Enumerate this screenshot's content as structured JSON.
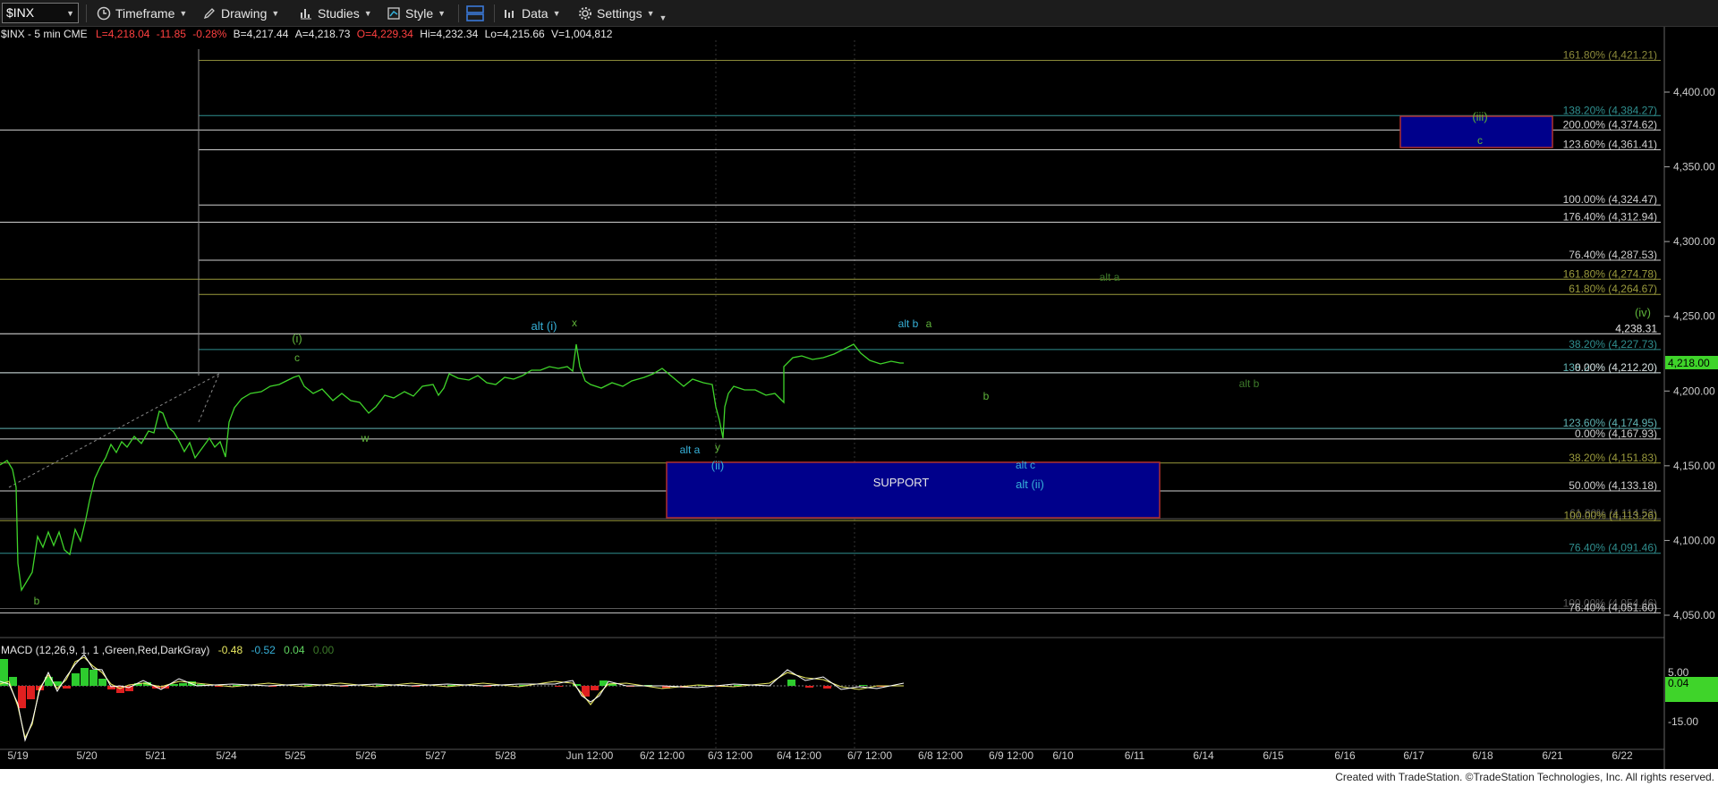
{
  "toolbar": {
    "symbol": "$INX",
    "timeframe": "Timeframe",
    "drawing": "Drawing",
    "studies": "Studies",
    "style": "Style",
    "data": "Data",
    "settings": "Settings"
  },
  "header": {
    "name": "$INX - 5 min  CME",
    "last": "L=4,218.04",
    "change": "-11.85",
    "pct": "-0.28%",
    "bid": "B=4,217.44",
    "ask": "A=4,218.73",
    "open": "O=4,229.34",
    "hi": "Hi=4,232.34",
    "lo": "Lo=4,215.66",
    "vol": "V=1,004,812"
  },
  "price_axis": [
    "4,400.00",
    "4,350.00",
    "4,300.00",
    "4,250.00",
    "4,200.00",
    "4,150.00",
    "4,100.00",
    "4,050.00"
  ],
  "last_price_tag": "4,218.00",
  "time_axis": [
    "5/19",
    "5/20",
    "5/21",
    "5/24",
    "5/25",
    "5/26",
    "5/27",
    "5/28",
    "Jun 12:00",
    "6/2 12:00",
    "6/3 12:00",
    "6/4 12:00",
    "6/7 12:00",
    "6/8 12:00",
    "6/9 12:00",
    "6/10",
    "6/11",
    "6/14",
    "6/15",
    "6/16",
    "6/17",
    "6/18",
    "6/21",
    "6/22"
  ],
  "fib_levels": [
    {
      "label": "161.80% (4,421.21)",
      "value": 4421.21,
      "color": "#8c8a3a"
    },
    {
      "label": "138.20% (4,384.27)",
      "value": 4384.27,
      "color": "#2f8f8f"
    },
    {
      "label": "200.00% (4,374.62)",
      "value": 4374.62,
      "color": "#cfcfcf"
    },
    {
      "label": "123.60% (4,361.41)",
      "value": 4361.41,
      "color": "#cfcfcf"
    },
    {
      "label": "100.00% (4,324.47)",
      "value": 4324.47,
      "color": "#cfcfcf"
    },
    {
      "label": "176.40% (4,312.94)",
      "value": 4312.94,
      "color": "#cfcfcf"
    },
    {
      "label": "76.40% (4,287.53)",
      "value": 4287.53,
      "color": "#cfcfcf"
    },
    {
      "label": "161.80% (4,274.78)",
      "value": 4274.78,
      "color": "#9a9a3c"
    },
    {
      "label": "61.80% (4,264.67)",
      "value": 4264.67,
      "color": "#9a9a3c"
    },
    {
      "label": "4,238.31",
      "value": 4238.31,
      "color": "#e6e6e6"
    },
    {
      "label": "38.20% (4,227.73)",
      "value": 4227.73,
      "color": "#2f8f8f"
    },
    {
      "label": "138.20% (4,212.20)",
      "value": 4212.2,
      "color": "#5fb4b4"
    },
    {
      "label": "0.00% (4,212.20)",
      "value": 4212.2,
      "color": "#cfcfcf"
    },
    {
      "label": "123.60% (4,174.95)",
      "value": 4174.95,
      "color": "#5fb4b4"
    },
    {
      "label": "0.00% (4,167.93)",
      "value": 4167.93,
      "color": "#cfcfcf"
    },
    {
      "label": "38.20% (4,151.83)",
      "value": 4151.83,
      "color": "#9a9a3c"
    },
    {
      "label": "50.00% (4,133.18)",
      "value": 4133.18,
      "color": "#cfcfcf"
    },
    {
      "label": "61.80% (4,114.53)",
      "value": 4114.53,
      "color": "#5a5a5a"
    },
    {
      "label": "100.00% (4,113.26)",
      "value": 4113.26,
      "color": "#9a9a3c"
    },
    {
      "label": "76.40% (4,091.46)",
      "value": 4091.46,
      "color": "#2f8f8f"
    },
    {
      "label": "100.00% (4,054.46)",
      "value": 4054.46,
      "color": "#5a5a5a"
    },
    {
      "label": "76.40% (4,051.60)",
      "value": 4051.6,
      "color": "#cfcfcf"
    }
  ],
  "wave_labels": [
    {
      "text": "(i)",
      "color": "#5fb33a"
    },
    {
      "text": "c",
      "color": "#5fb33a"
    },
    {
      "text": "w",
      "color": "#5fb33a"
    },
    {
      "text": "b",
      "color": "#5fb33a"
    },
    {
      "text": "alt (i)",
      "color": "#36b0d8"
    },
    {
      "text": "x",
      "color": "#5fb33a"
    },
    {
      "text": "alt a",
      "color": "#36b0d8"
    },
    {
      "text": "y",
      "color": "#5fb33a"
    },
    {
      "text": "(ii)",
      "color": "#36b0d8"
    },
    {
      "text": "alt b",
      "color": "#36b0d8"
    },
    {
      "text": "a",
      "color": "#5fb33a"
    },
    {
      "text": "b",
      "color": "#5fb33a"
    },
    {
      "text": "alt c",
      "color": "#36b0d8"
    },
    {
      "text": "alt (ii)",
      "color": "#36b0d8"
    },
    {
      "text": "alt a",
      "color": "#3d7a2a"
    },
    {
      "text": "alt b",
      "color": "#3d7a2a"
    },
    {
      "text": "(iv)",
      "color": "#5fb33a"
    },
    {
      "text": "(iii)",
      "color": "#5fb33a"
    },
    {
      "text": "c",
      "color": "#5fb33a"
    }
  ],
  "support_label": "SUPPORT",
  "macd": {
    "title": "MACD (12,26,9, 1, 1 ,Green,Red,DarkGray)",
    "values": [
      "-0.48",
      "-0.52",
      "0.04",
      "0.00"
    ],
    "value_colors": [
      "#e8e860",
      "#36b0d8",
      "#5fd35f",
      "#3d7a2a"
    ],
    "axis": [
      "5.00",
      "-15.00"
    ],
    "tag": "0.04"
  },
  "footer": "Created with TradeStation. ©TradeStation Technologies, Inc. All rights reserved.",
  "colors": {
    "price": "#3fd42a",
    "zone": "#00008b",
    "zone_border": "#b03030"
  }
}
